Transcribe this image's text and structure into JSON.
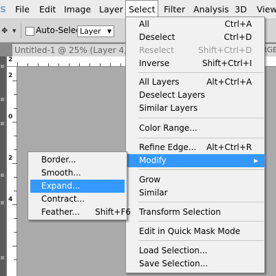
{
  "menubar": {
    "logo": "S",
    "items": [
      "File",
      "Edit",
      "Image",
      "Layer",
      "Select",
      "Filter",
      "Analysis",
      "3D",
      "View"
    ]
  },
  "options": {
    "auto_select_label": "Auto-Select:",
    "auto_select_value": "Layer"
  },
  "document": {
    "tab_title": "Untitled-1 @ 25% (Layer 4, RGB",
    "tab2_partial": "RGB",
    "ruler_h": [
      "2"
    ],
    "ruler_v": [
      "2",
      "0",
      "2",
      "4"
    ]
  },
  "select_menu": {
    "items": [
      {
        "label": "All",
        "shortcut": "Ctrl+A"
      },
      {
        "label": "Deselect",
        "shortcut": "Ctrl+D"
      },
      {
        "label": "Reselect",
        "shortcut": "Shift+Ctrl+D"
      },
      {
        "label": "Inverse",
        "shortcut": "Shift+Ctrl+I"
      },
      {
        "label": "All Layers",
        "shortcut": "Alt+Ctrl+A"
      },
      {
        "label": "Deselect Layers",
        "shortcut": ""
      },
      {
        "label": "Similar Layers",
        "shortcut": ""
      },
      {
        "label": "Color Range...",
        "shortcut": ""
      },
      {
        "label": "Refine Edge...",
        "shortcut": "Alt+Ctrl+R"
      },
      {
        "label": "Modify",
        "shortcut": ""
      },
      {
        "label": "Grow",
        "shortcut": ""
      },
      {
        "label": "Similar",
        "shortcut": ""
      },
      {
        "label": "Transform Selection",
        "shortcut": ""
      },
      {
        "label": "Edit in Quick Mask Mode",
        "shortcut": ""
      },
      {
        "label": "Load Selection...",
        "shortcut": ""
      },
      {
        "label": "Save Selection...",
        "shortcut": ""
      }
    ],
    "disabled": [
      "Reselect"
    ],
    "highlighted": "Modify"
  },
  "modify_menu": {
    "items": [
      {
        "label": "Border...",
        "shortcut": ""
      },
      {
        "label": "Smooth...",
        "shortcut": ""
      },
      {
        "label": "Expand...",
        "shortcut": ""
      },
      {
        "label": "Contract...",
        "shortcut": ""
      },
      {
        "label": "Feather...",
        "shortcut": "Shift+F6"
      }
    ],
    "highlighted": "Expand..."
  },
  "colors": {
    "highlight": "#3399ff",
    "menu_bg": "#f1f1f1",
    "disabled_text": "#9a9a9a"
  }
}
